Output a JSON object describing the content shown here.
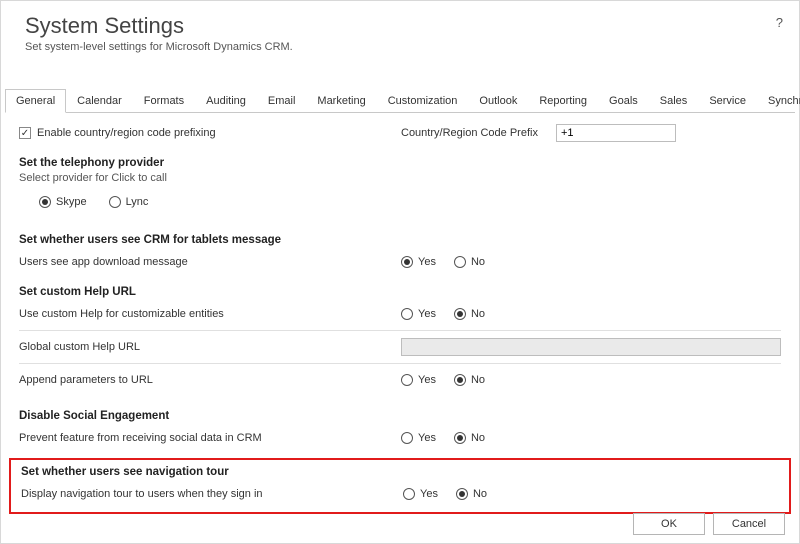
{
  "header": {
    "title": "System Settings",
    "subtitle": "Set system-level settings for Microsoft Dynamics CRM.",
    "help": "?"
  },
  "tabs": [
    "General",
    "Calendar",
    "Formats",
    "Auditing",
    "Email",
    "Marketing",
    "Customization",
    "Outlook",
    "Reporting",
    "Goals",
    "Sales",
    "Service",
    "Synchronization"
  ],
  "activeTab": "General",
  "prefix": {
    "checkbox_label": "Enable country/region code prefixing",
    "checked": true,
    "field_label": "Country/Region Code Prefix",
    "value": "+1"
  },
  "telephony": {
    "title": "Set the telephony provider",
    "desc": "Select provider for Click to call",
    "options": [
      "Skype",
      "Lync"
    ],
    "selected": "Skype"
  },
  "tablets": {
    "title": "Set whether users see CRM for tablets message",
    "label": "Users see app download message",
    "value": "Yes"
  },
  "help": {
    "title": "Set custom Help URL",
    "custom_label": "Use custom Help for customizable entities",
    "custom_value": "No",
    "url_label": "Global custom Help URL",
    "url_value": "",
    "append_label": "Append parameters to URL",
    "append_value": "No"
  },
  "social": {
    "title": "Disable Social Engagement",
    "label": "Prevent feature from receiving social data in CRM",
    "value": "No"
  },
  "navtour": {
    "title": "Set whether users see navigation tour",
    "label": "Display navigation tour to users when they sign in",
    "value": "No"
  },
  "yesno": {
    "yes": "Yes",
    "no": "No"
  },
  "buttons": {
    "ok": "OK",
    "cancel": "Cancel"
  }
}
